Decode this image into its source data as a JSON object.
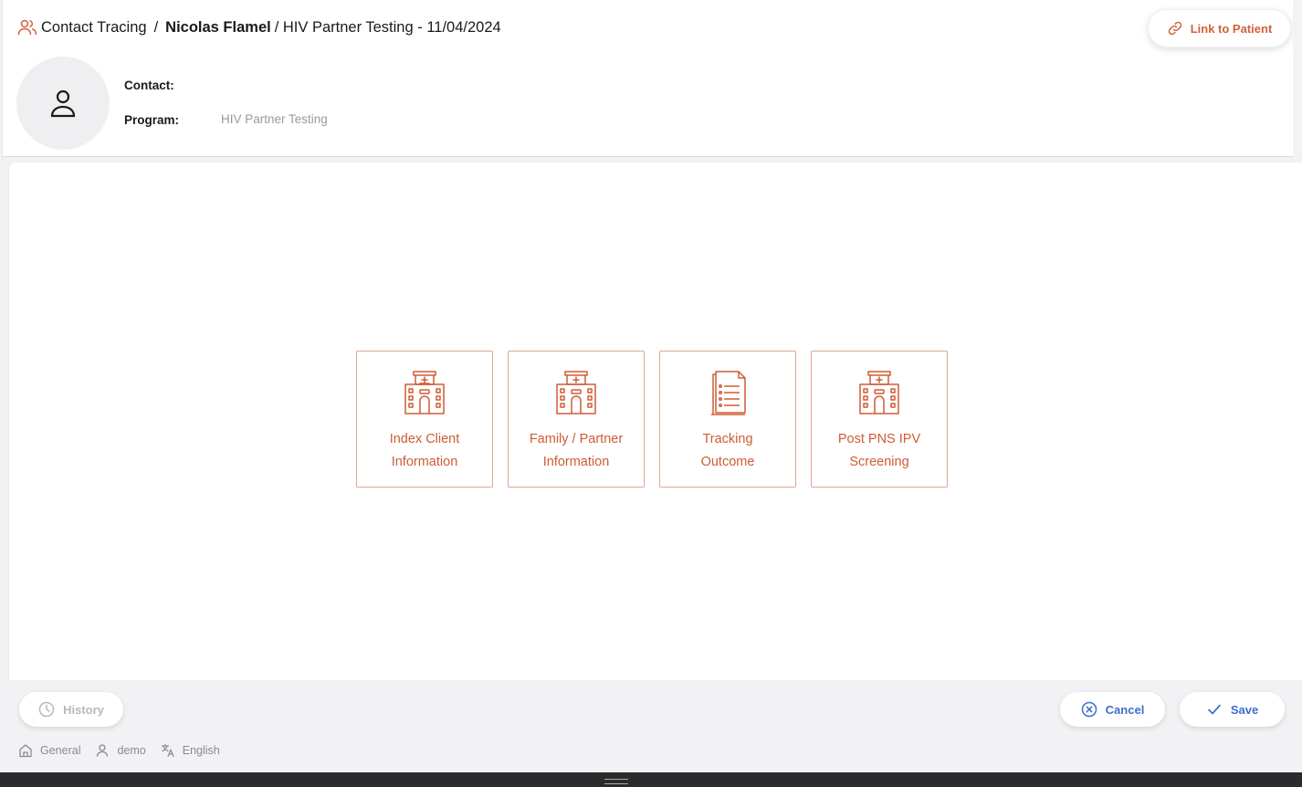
{
  "header": {
    "breadcrumb": {
      "root": "Contact Tracing",
      "separator": "/",
      "patient_name": "Nicolas Flamel",
      "trail": "/ HIV Partner Testing - 11/04/2024"
    },
    "link_button_label": "Link to Patient",
    "contact_label": "Contact:",
    "contact_value": "",
    "program_label": "Program:",
    "program_value": "HIV Partner Testing"
  },
  "cards": [
    {
      "line1": "Index Client",
      "line2": "Information",
      "icon": "hospital-icon"
    },
    {
      "line1": "Family / Partner",
      "line2": "Information",
      "icon": "hospital-icon"
    },
    {
      "line1": "Tracking",
      "line2": "Outcome",
      "icon": "document-list-icon"
    },
    {
      "line1": "Post PNS IPV",
      "line2": "Screening",
      "icon": "hospital-icon"
    }
  ],
  "footer": {
    "history_label": "History",
    "cancel_label": "Cancel",
    "save_label": "Save",
    "status": {
      "location": "General",
      "user": "demo",
      "language": "English"
    }
  },
  "colors": {
    "accent": "#d4603a",
    "primary_action": "#3d6fc9",
    "disabled": "#b8b8bc"
  }
}
